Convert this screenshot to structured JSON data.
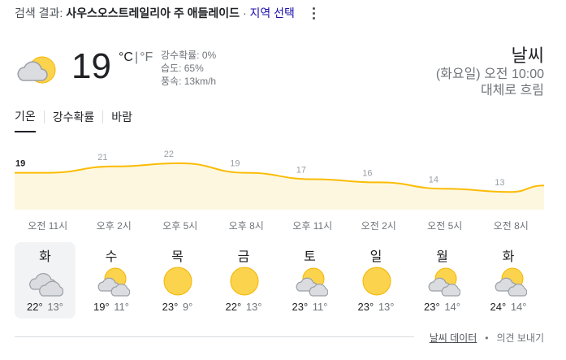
{
  "header": {
    "prefix": "검색 결과: ",
    "location": "사우스오스트레일리아 주 애들레이드",
    "separator": " · ",
    "region_link": "지역 선택"
  },
  "current": {
    "temperature": "19",
    "unit_c": "°C",
    "unit_sep": "|",
    "unit_f": "°F",
    "details": [
      "강수확률: 0%",
      "습도: 65%",
      "풍속: 13km/h"
    ],
    "icon": "partly-cloudy-icon"
  },
  "info": {
    "title": "날씨",
    "time": "(화요일) 오전 10:00",
    "condition": "대체로 흐림"
  },
  "tabs": [
    {
      "label": "기온",
      "active": true
    },
    {
      "label": "강수확률",
      "active": false
    },
    {
      "label": "바람",
      "active": false
    }
  ],
  "chart_data": {
    "type": "area",
    "title": "",
    "xlabel": "",
    "ylabel": "",
    "categories": [
      "오전 11시",
      "오후 2시",
      "오후 5시",
      "오후 8시",
      "오후 11시",
      "오전 2시",
      "오전 5시",
      "오전 8시"
    ],
    "values": [
      19,
      21,
      22,
      19,
      17,
      16,
      14,
      13
    ],
    "data_labels": [
      "19",
      "21",
      "22",
      "19",
      "17",
      "16",
      "14",
      "13"
    ],
    "line_color": "#fbbc04",
    "fill_color": "#fef7e0"
  },
  "forecast": [
    {
      "day": "화",
      "icon": "cloudy-icon",
      "high": "22°",
      "low": "13°",
      "selected": true
    },
    {
      "day": "수",
      "icon": "partly-cloudy-icon",
      "high": "19°",
      "low": "11°",
      "selected": false
    },
    {
      "day": "목",
      "icon": "sunny-icon",
      "high": "23°",
      "low": "9°",
      "selected": false
    },
    {
      "day": "금",
      "icon": "sunny-icon",
      "high": "22°",
      "low": "13°",
      "selected": false
    },
    {
      "day": "토",
      "icon": "partly-cloudy-icon",
      "high": "23°",
      "low": "11°",
      "selected": false
    },
    {
      "day": "일",
      "icon": "sunny-icon",
      "high": "23°",
      "low": "13°",
      "selected": false
    },
    {
      "day": "월",
      "icon": "partly-cloudy-icon",
      "high": "23°",
      "low": "14°",
      "selected": false
    },
    {
      "day": "화",
      "icon": "partly-cloudy-icon",
      "high": "24°",
      "low": "14°",
      "selected": false
    }
  ],
  "footer": {
    "data_link": "날씨 데이터",
    "bullet": "•",
    "feedback": "의견 보내기"
  },
  "colors": {
    "sun": "#fcd34d",
    "sun_outline": "#f4b400",
    "cloud": "#dadce0",
    "cloud_outline": "#9aa0a6",
    "link": "#1a0dab"
  }
}
